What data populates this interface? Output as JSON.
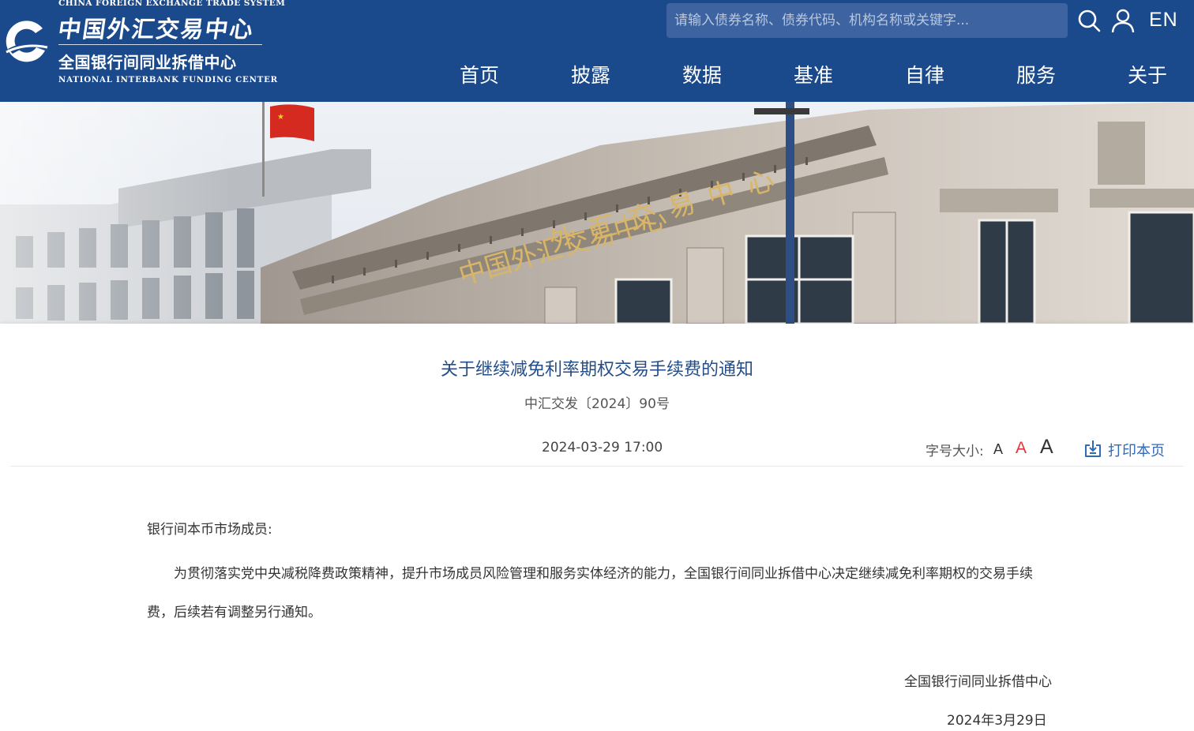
{
  "header": {
    "logo": {
      "top_en": "CHINA FOREIGN EXCHANGE TRADE SYSTEM",
      "cfets_cn": "中国外汇交易中心",
      "nifc_cn": "全国银行间同业拆借中心",
      "nifc_en": "NATIONAL INTERBANK FUNDING CENTER"
    },
    "search": {
      "placeholder": "请输入债券名称、债券代码、机构名称或关键字..."
    },
    "icons": [
      "search-icon",
      "user-icon"
    ],
    "lang": "EN",
    "nav": [
      "首页",
      "披露",
      "数据",
      "基准",
      "自律",
      "服务",
      "关于"
    ]
  },
  "banner": {
    "building_sign": "中国外汇交易中心"
  },
  "article": {
    "title": "关于继续减免利率期权交易手续费的通知",
    "doc_number": "中汇交发〔2024〕90号",
    "date": "2024-03-29 17:00",
    "font_size_label": "字号大小:",
    "font_sizes": [
      "A",
      "A",
      "A"
    ],
    "print_label": "打印本页",
    "salutation": "银行间本币市场成员:",
    "paragraph": "为贯彻落实党中央减税降费政策精神，提升市场成员风险管理和服务实体经济的能力，全国银行间同业拆借中心决定继续减免利率期权的交易手续费，后续若有调整另行通知。",
    "signature": "全国银行间同业拆借中心",
    "sign_date": "2024年3月29日"
  },
  "colors": {
    "header_bg": "#1b4a8c",
    "title": "#244e8a",
    "active_font_size": "#e5343a",
    "print_link": "#2f6ab8"
  }
}
